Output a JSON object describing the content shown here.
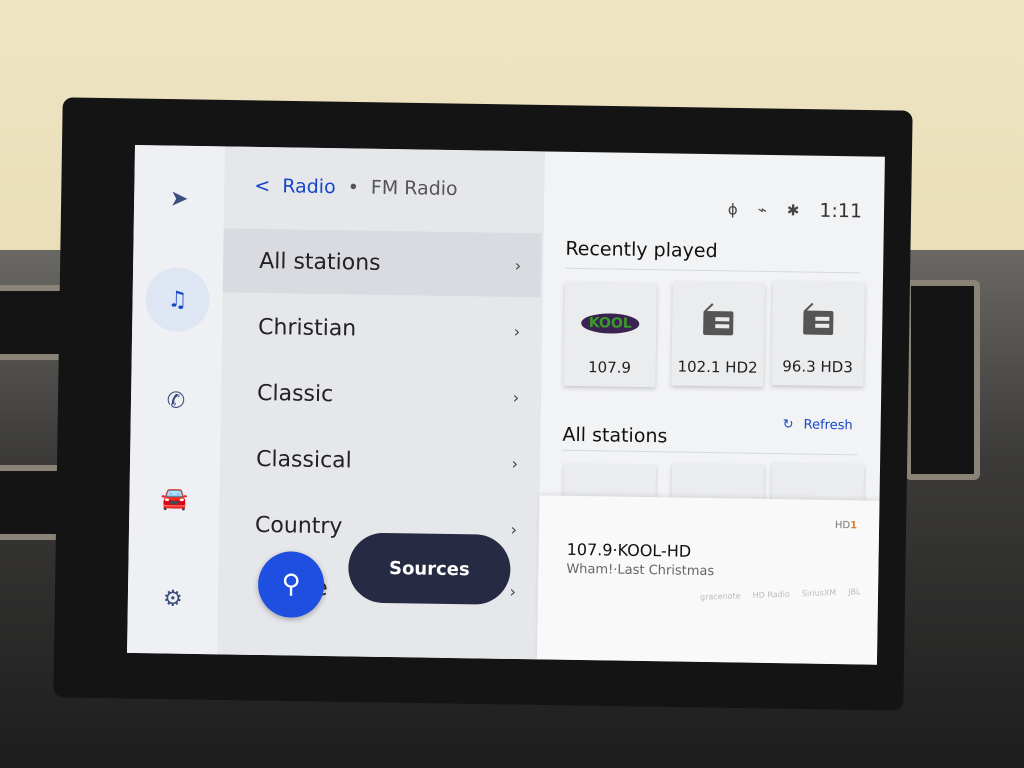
{
  "rail": [
    {
      "icon": "navigation-icon",
      "glyph": "➤"
    },
    {
      "icon": "music-icon",
      "glyph": "♫",
      "active": true
    },
    {
      "icon": "phone-icon",
      "glyph": "✆"
    },
    {
      "icon": "car-icon",
      "glyph": "🚘"
    },
    {
      "icon": "gear-icon",
      "glyph": "⚙"
    }
  ],
  "header": {
    "back": "<",
    "title": "Radio",
    "separator": "•",
    "subtitle": "FM Radio"
  },
  "categories": [
    {
      "label": "All stations",
      "selected": true
    },
    {
      "label": "Christian"
    },
    {
      "label": "Classic"
    },
    {
      "label": "Classical"
    },
    {
      "label": "Country"
    },
    {
      "label": "e"
    }
  ],
  "chevron": "›",
  "search": {
    "icon": "search-icon",
    "glyph": "⚲"
  },
  "sources_label": "Sources",
  "status": {
    "time": "1:11"
  },
  "recently_played": {
    "title": "Recently played",
    "stations": [
      {
        "label": "107.9",
        "logo": "KOOL"
      },
      {
        "label": "102.1 HD2"
      },
      {
        "label": "96.3 HD3"
      }
    ]
  },
  "all_stations": {
    "title": "All stations",
    "refresh": "Refresh"
  },
  "now_playing": {
    "station": "107.9·KOOL-HD",
    "track": "Wham!·Last Christmas",
    "hd": "HD",
    "hd_channel": "1"
  },
  "brands": [
    "gracenote",
    "HD Radio",
    "SiriusXM",
    "JBL"
  ],
  "colors": {
    "accent": "#1546c8",
    "sources": "#272a43",
    "search": "#1f4fe0"
  }
}
